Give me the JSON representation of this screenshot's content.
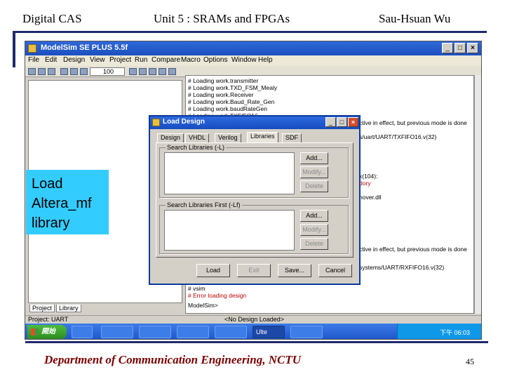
{
  "slide": {
    "header_left": "Digital CAS",
    "header_center": "Unit 5 : SRAMs and FPGAs",
    "header_right": "Sau-Hsuan Wu",
    "footer": "Department of Communication Engineering, NCTU",
    "page_number": "45",
    "callout_lines": [
      "Load",
      "Altera_mf",
      "library"
    ],
    "colors": {
      "accent": "#1f2a6b",
      "footer_text": "#7a0000",
      "callout_bg": "#33ccff"
    }
  },
  "app": {
    "title": "ModelSim SE PLUS 5.5f",
    "menu": [
      "File",
      "Edit",
      "Design",
      "View",
      "Project",
      "Run",
      "Compare",
      "Macro",
      "Options",
      "Window",
      "Help"
    ],
    "zoom_value": "100",
    "workspace_tabs": [
      "Project",
      "Library"
    ],
    "status_project": "Project: UART",
    "status_design": "<No Design Loaded>",
    "transcript_lines": [
      "# Loading work.transmitter",
      "# Loading work.TXD_FSM_Mealy",
      "# Loading work.Receiver",
      "# Loading work.Baud_Rate_Gen",
      "# Loading work.baudRateGen",
      "# Loading work.TXFIFO16"
    ],
    "transcript_right_fragments": [
      "ctive in effect, but previous mode is done",
      "s/uart/UART/TXFIFO16.v(32)",
      "x(104):",
      "dory",
      "hover.dll",
      "ctive in effect, but previous mode is done",
      "systems/UART/RXFIFO16.v(32)"
    ],
    "transcript_bottom": [
      "# vsim",
      "# Error loading design",
      "ModelSim>"
    ]
  },
  "dialog": {
    "title": "Load Design",
    "tabs": [
      "Design",
      "VHDL",
      "Verilog",
      "Libraries",
      "SDF"
    ],
    "active_tab": "Libraries",
    "group1_label": "Search Libraries (-L)",
    "group2_label": "Search Libraries First (-Lf)",
    "group1_buttons": [
      "Add...",
      "Modify...",
      "Delete"
    ],
    "group2_buttons": [
      "Add...",
      "Modify...",
      "Delete"
    ],
    "bottom_buttons": [
      "Load",
      "Exit",
      "Save...",
      "Cancel"
    ]
  },
  "taskbar": {
    "start_label": "開始",
    "tasks": [
      "",
      "",
      "",
      "Ulte",
      "",
      "",
      ""
    ],
    "clock": "下午 06:03"
  }
}
